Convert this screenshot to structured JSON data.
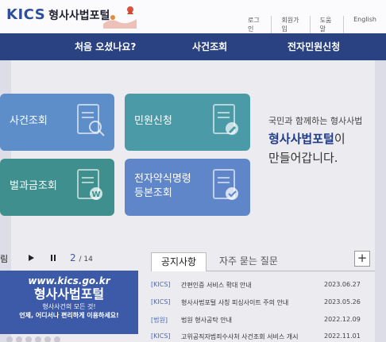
{
  "header": {
    "logo_text": "KICS",
    "site_name": "형사사법포털",
    "util_links": [
      "로그인",
      "회원가입",
      "도움말",
      "English"
    ]
  },
  "main_nav": [
    "처음 오셨나요?",
    "사건조회",
    "전자민원신청"
  ],
  "tiles": [
    {
      "label": "사건조회",
      "icon": "search-document-icon"
    },
    {
      "label": "민원신청",
      "icon": "edit-document-icon"
    },
    {
      "label": "벌과금조회",
      "icon": "won-document-icon"
    },
    {
      "label_line1": "전자약식명령",
      "label_line2": "등본조회",
      "icon": "check-document-icon"
    }
  ],
  "intro": {
    "line1": "국민과 함께하는 형사사법",
    "brand": "형사사법포털",
    "brand_suffix": "이",
    "line3": "만들어갑니다."
  },
  "banner": {
    "left_label": "림",
    "play_icon": "play-icon",
    "pause_icon": "pause-icon",
    "current": "2",
    "total": "/ 14"
  },
  "tabs": {
    "active": "공지사항",
    "inactive": "자주 묻는 질문",
    "more_icon": "plus-icon",
    "more_label": "+"
  },
  "notices": [
    {
      "tag": "[KICS]",
      "title": "간편인증 서비스 확대 안내",
      "date": "2023.06.27"
    },
    {
      "tag": "[KICS]",
      "title": "형사사법포털 사칭 피싱사이트 주의 안내",
      "date": "2023.05.26"
    },
    {
      "tag": "[법원]",
      "title": "법원 형사공탁 안내",
      "date": "2022.12.09"
    },
    {
      "tag": "[KICS]",
      "title": "고위공직자범죄수사처 사건조회 서비스 개시",
      "date": "2022.11.01"
    }
  ],
  "promo": {
    "url": "www.kics.go.kr",
    "headline": "형사사법포털",
    "tagline": "형사사건의 모든 것!",
    "tagline2": "언제, 어디서나 편리하게 이용하세요!"
  },
  "colors": {
    "nav_bg": "#2b4282",
    "tile_blue": "#5e8ec9",
    "tile_teal": "#4a9aa8",
    "brand_blue": "#1f3c88"
  }
}
